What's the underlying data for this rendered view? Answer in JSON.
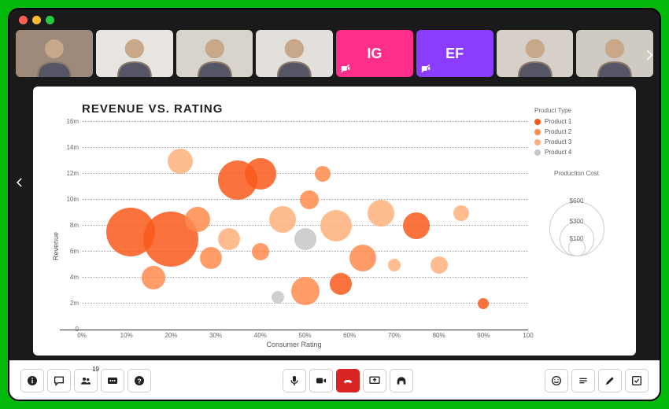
{
  "window": {
    "traffic": {
      "close": "#ff5f57",
      "min": "#febc2e",
      "max": "#28c840"
    }
  },
  "participants": {
    "video": [
      {
        "name": "participant-1",
        "bg": "#9d8a7a"
      },
      {
        "name": "participant-2",
        "bg": "#e8e4df"
      },
      {
        "name": "participant-3",
        "bg": "#d8d3cb"
      },
      {
        "name": "participant-4",
        "bg": "#e3dfda"
      }
    ],
    "initials": [
      {
        "name": "participant-5",
        "text": "IG",
        "bg": "#ff2e8a"
      },
      {
        "name": "participant-6",
        "text": "EF",
        "bg": "#8a3dff"
      }
    ],
    "video_tail": [
      {
        "name": "participant-7",
        "bg": "#d6d0c8"
      },
      {
        "name": "participant-8",
        "bg": "#cfcac2"
      }
    ],
    "count_badge": "19"
  },
  "chart_data": {
    "type": "bubble",
    "title": "REVENUE VS. RATING",
    "xlabel": "Consumer Rating",
    "ylabel": "Revenue",
    "xlim": [
      0,
      100
    ],
    "ylim": [
      0,
      16
    ],
    "xticks": [
      "0%",
      "10%",
      "20%",
      "30%",
      "40%",
      "50%",
      "60%",
      "70%",
      "80%",
      "90%",
      "100"
    ],
    "yticks": [
      "0",
      "2m",
      "4m",
      "6m",
      "8m",
      "10m",
      "12m",
      "14m",
      "16m"
    ],
    "legend_title": "Product Type",
    "legend": [
      {
        "name": "Product 1",
        "color": "#f9591b"
      },
      {
        "name": "Product 2",
        "color": "#ff8b4d"
      },
      {
        "name": "Product 3",
        "color": "#ffb07a"
      },
      {
        "name": "Product 4",
        "color": "#c7c7c7"
      }
    ],
    "size_legend": {
      "title": "Production Cost",
      "levels": [
        {
          "label": "$600",
          "d": 70
        },
        {
          "label": "$300",
          "d": 44
        },
        {
          "label": "$100",
          "d": 22
        }
      ]
    },
    "points": [
      {
        "x": 11,
        "y": 7.5,
        "size": 62,
        "series": 0
      },
      {
        "x": 20,
        "y": 7,
        "size": 70,
        "series": 0
      },
      {
        "x": 22,
        "y": 13,
        "size": 32,
        "series": 2
      },
      {
        "x": 16,
        "y": 4,
        "size": 30,
        "series": 1
      },
      {
        "x": 26,
        "y": 8.5,
        "size": 32,
        "series": 1
      },
      {
        "x": 29,
        "y": 5.5,
        "size": 28,
        "series": 1
      },
      {
        "x": 35,
        "y": 11.5,
        "size": 50,
        "series": 0
      },
      {
        "x": 33,
        "y": 7,
        "size": 28,
        "series": 2
      },
      {
        "x": 40,
        "y": 12,
        "size": 40,
        "series": 0
      },
      {
        "x": 40,
        "y": 6,
        "size": 22,
        "series": 1
      },
      {
        "x": 44,
        "y": 2.5,
        "size": 16,
        "series": 3
      },
      {
        "x": 45,
        "y": 8.5,
        "size": 34,
        "series": 2
      },
      {
        "x": 50,
        "y": 3,
        "size": 36,
        "series": 1
      },
      {
        "x": 51,
        "y": 10,
        "size": 24,
        "series": 1
      },
      {
        "x": 50,
        "y": 7,
        "size": 28,
        "series": 3
      },
      {
        "x": 54,
        "y": 12,
        "size": 20,
        "series": 1
      },
      {
        "x": 57,
        "y": 8,
        "size": 40,
        "series": 2
      },
      {
        "x": 58,
        "y": 3.5,
        "size": 28,
        "series": 0
      },
      {
        "x": 63,
        "y": 5.5,
        "size": 34,
        "series": 1
      },
      {
        "x": 67,
        "y": 9,
        "size": 34,
        "series": 2
      },
      {
        "x": 70,
        "y": 5,
        "size": 16,
        "series": 2
      },
      {
        "x": 75,
        "y": 8,
        "size": 34,
        "series": 0
      },
      {
        "x": 80,
        "y": 5,
        "size": 22,
        "series": 2
      },
      {
        "x": 85,
        "y": 9,
        "size": 20,
        "series": 2
      },
      {
        "x": 90,
        "y": 2,
        "size": 14,
        "series": 0
      }
    ]
  },
  "toolbar": {
    "left": [
      {
        "name": "info-button",
        "icon": "info"
      },
      {
        "name": "chat-button",
        "icon": "chat"
      },
      {
        "name": "participants-button",
        "icon": "people",
        "badge": "19"
      },
      {
        "name": "captions-button",
        "icon": "cc"
      },
      {
        "name": "help-button",
        "icon": "help"
      }
    ],
    "center": [
      {
        "name": "mute-button",
        "icon": "mic"
      },
      {
        "name": "video-button",
        "icon": "camera"
      },
      {
        "name": "end-call-button",
        "icon": "hangup",
        "red": true
      },
      {
        "name": "share-screen-button",
        "icon": "present"
      },
      {
        "name": "audio-settings-button",
        "icon": "headset"
      }
    ],
    "right": [
      {
        "name": "reactions-button",
        "icon": "smile"
      },
      {
        "name": "notes-button",
        "icon": "lines"
      },
      {
        "name": "annotate-button",
        "icon": "pencil"
      },
      {
        "name": "tasks-button",
        "icon": "checkbox"
      }
    ]
  }
}
